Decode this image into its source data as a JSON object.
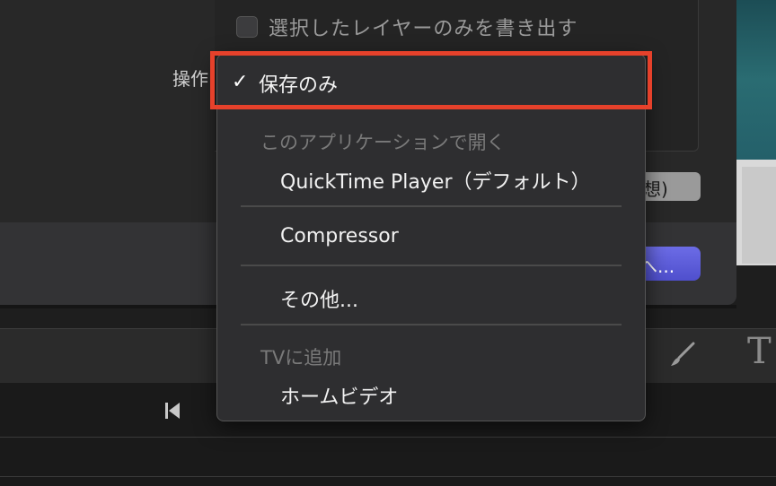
{
  "background": {
    "export_selected_layers_label": "選択したレイヤーのみを書き出す",
    "operation_label": "操作",
    "partial_pill_text": "想)",
    "next_button_label": "へ..."
  },
  "menu": {
    "selected_item": "保存のみ",
    "check_glyph": "✓",
    "open_with_heading": "このアプリケーションで開く",
    "quicktime": "QuickTime Player（デフォルト）",
    "compressor": "Compressor",
    "other": "その他...",
    "tv_heading": "TVに追加",
    "home_video": "ホームビデオ"
  },
  "toolbar": {
    "text_tool_glyph": "T"
  },
  "colors": {
    "highlight": "#e6412b",
    "accent_button": "#5a5ad8",
    "menu_bg": "#2e2e30"
  },
  "icons": [
    "checkbox-icon",
    "brush-icon",
    "text-tool-icon",
    "prev-frame-icon",
    "check-icon"
  ]
}
